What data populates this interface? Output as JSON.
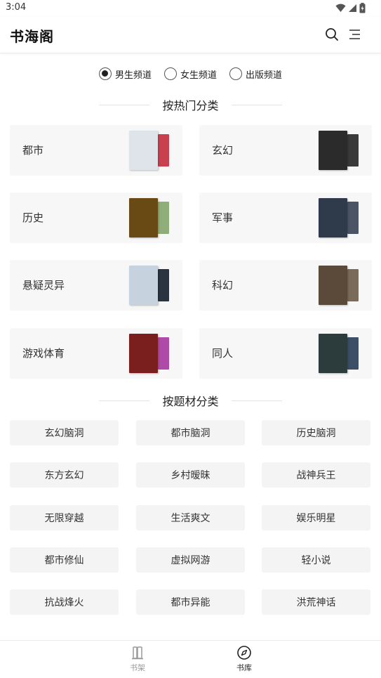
{
  "status_bar": {
    "time": "3:04"
  },
  "app_bar": {
    "title": "书海阁"
  },
  "channels": [
    {
      "label": "男生频道",
      "selected": true
    },
    {
      "label": "女生频道",
      "selected": false
    },
    {
      "label": "出版频道",
      "selected": false
    }
  ],
  "hot_section": {
    "title": "按热门分类"
  },
  "hot_categories": [
    {
      "name": "都市",
      "cover_front": "#dfe3ea",
      "cover_back": "#c9414f"
    },
    {
      "name": "玄幻",
      "cover_front": "#2b2b2b",
      "cover_back": "#3a3a3a"
    },
    {
      "name": "历史",
      "cover_front": "#6a4a14",
      "cover_back": "#8fae7a"
    },
    {
      "name": "军事",
      "cover_front": "#2f3a4a",
      "cover_back": "#4b5566"
    },
    {
      "name": "悬疑灵异",
      "cover_front": "#c6d3de",
      "cover_back": "#2a3440"
    },
    {
      "name": "科幻",
      "cover_front": "#5b4a3a",
      "cover_back": "#7a6a5a"
    },
    {
      "name": "游戏体育",
      "cover_front": "#7a1e1e",
      "cover_back": "#b04aa8"
    },
    {
      "name": "同人",
      "cover_front": "#2c3b3c",
      "cover_back": "#3c4f66"
    }
  ],
  "theme_section": {
    "title": "按题材分类"
  },
  "theme_tags": [
    "玄幻脑洞",
    "都市脑洞",
    "历史脑洞",
    "东方玄幻",
    "乡村暧昧",
    "战神兵王",
    "无限穿越",
    "生活爽文",
    "娱乐明星",
    "都市修仙",
    "虚拟网游",
    "轻小说",
    "抗战烽火",
    "都市异能",
    "洪荒神话"
  ],
  "bottom_nav": [
    {
      "label": "书架",
      "active": false,
      "icon": "bookshelf-icon"
    },
    {
      "label": "书库",
      "active": true,
      "icon": "compass-icon"
    }
  ]
}
